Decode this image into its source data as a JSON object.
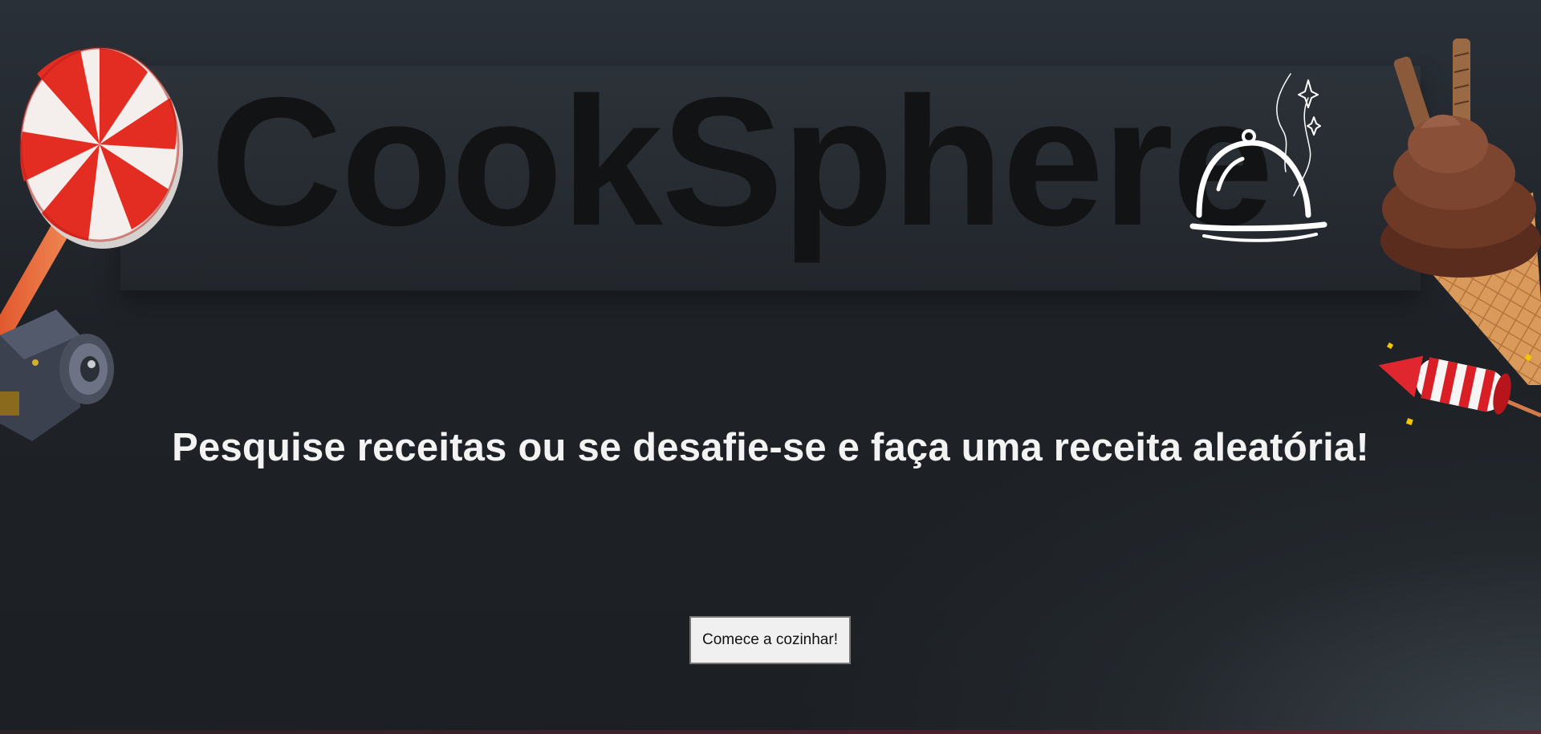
{
  "brand": {
    "title": "CookSphere",
    "logo_icon": "cloche-icon"
  },
  "hero": {
    "tagline": "Pesquise receitas ou se desafie-se e faça uma receita aleatória!"
  },
  "cta": {
    "label": "Comece a cozinhar!"
  },
  "decorations": [
    "lollipop-icon",
    "speaker-icon",
    "ice-cream-cone-icon",
    "firework-rocket-icon"
  ],
  "colors": {
    "background": "#1e2227",
    "title_text": "#121314",
    "tagline_text": "#f3f3f3",
    "button_bg": "#f0f0f0"
  }
}
